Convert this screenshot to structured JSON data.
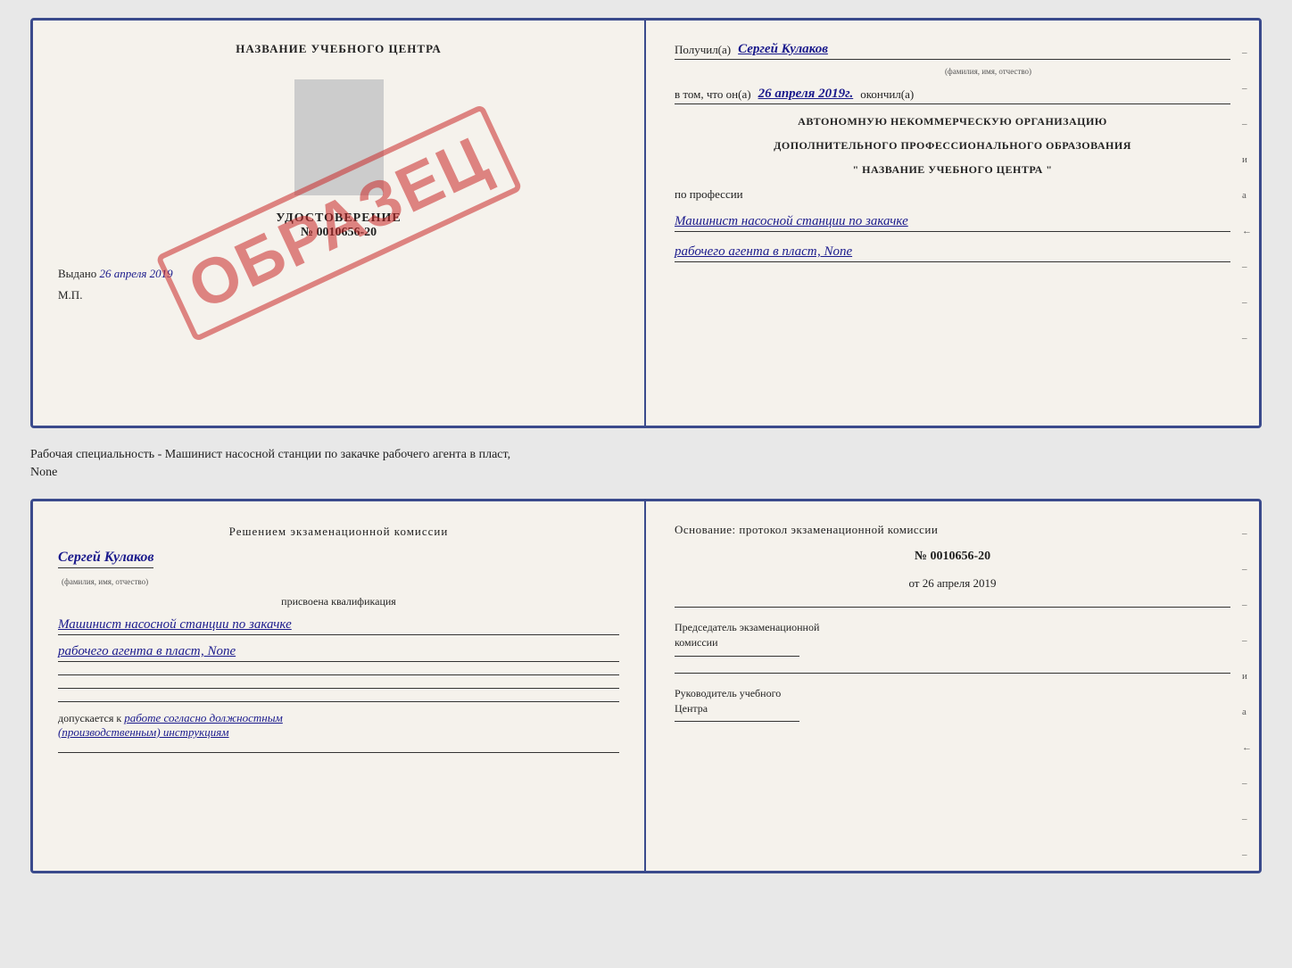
{
  "top_cert": {
    "left": {
      "title": "НАЗВАНИЕ УЧЕБНОГО ЦЕНТРА",
      "photo_alt": "photo",
      "udost_label": "УДОСТОВЕРЕНИЕ",
      "udost_number": "№ 0010656-20",
      "stamp": "ОБРАЗЕЦ",
      "vydano_label": "Выдано",
      "vydano_date": "26 апреля 2019",
      "mp": "М.П."
    },
    "right": {
      "poluchil_label": "Получил(а)",
      "poluchil_value": "Сергей Кулаков",
      "poluchil_sublabel": "(фамилия, имя, отчество)",
      "vtom_label": "в том, что он(а)",
      "vtom_date": "26 апреля 2019г.",
      "okonchil": "окончил(а)",
      "org_line1": "АВТОНОМНУЮ НЕКОММЕРЧЕСКУЮ ОРГАНИЗАЦИЮ",
      "org_line2": "ДОПОЛНИТЕЛЬНОГО ПРОФЕССИОНАЛЬНОГО ОБРАЗОВАНИЯ",
      "org_line3": "\"  НАЗВАНИЕ УЧЕБНОГО ЦЕНТРА  \"",
      "po_professii": "по профессии",
      "profession_line1": "Машинист насосной станции по закачке",
      "profession_line2": "рабочего агента в пласт, None",
      "side_chars": [
        "–",
        "–",
        "–",
        "и",
        "а",
        "←",
        "–",
        "–",
        "–"
      ]
    }
  },
  "subtitle": "Рабочая специальность - Машинист насосной станции по закачке рабочего агента в пласт,\nNone",
  "bottom_cert": {
    "left": {
      "section_title": "Решением  экзаменационной  комиссии",
      "name_value": "Сергей Кулаков",
      "name_sublabel": "(фамилия, имя, отчество)",
      "prisvoena": "присвоена квалификация",
      "profession_line1": "Машинист насосной станции по закачке",
      "profession_line2": "рабочего агента в пласт, None",
      "допускается_label": "допускается к",
      "допускается_value": "работе согласно должностным",
      "допускается_value2": "(производственным) инструкциям"
    },
    "right": {
      "osnov_title": "Основание: протокол экзаменационной  комиссии",
      "number": "№  0010656-20",
      "date_prefix": "от",
      "date_value": "26 апреля 2019",
      "predsedatel_label": "Председатель экзаменационной\nкомиссии",
      "rukovoditel_label": "Руководитель учебного\nЦентра",
      "side_chars": [
        "–",
        "–",
        "–",
        "–",
        "и",
        "а",
        "←",
        "–",
        "–",
        "–",
        "–"
      ]
    }
  }
}
